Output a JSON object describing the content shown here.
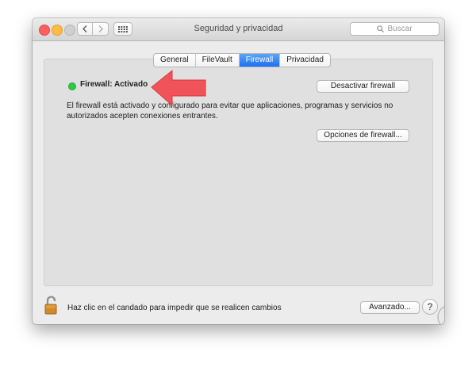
{
  "window": {
    "title": "Seguridad y privacidad",
    "search_placeholder": "Buscar"
  },
  "tabs": [
    {
      "label": "General",
      "active": false
    },
    {
      "label": "FileVault",
      "active": false
    },
    {
      "label": "Firewall",
      "active": true
    },
    {
      "label": "Privacidad",
      "active": false
    }
  ],
  "firewall": {
    "status_label": "Firewall: Activado",
    "status_color": "#2ecb40",
    "description": "El firewall está activado y configurado para evitar que aplicaciones, programas y servicios no autorizados acepten conexiones entrantes.",
    "deactivate_button": "Desactivar firewall",
    "options_button": "Opciones de firewall..."
  },
  "footer": {
    "lock_text": "Haz clic en el candado para impedir que se realicen cambios",
    "advanced_button": "Avanzado...",
    "help_label": "?"
  },
  "icons": {
    "lock": "unlocked-padlock-icon",
    "arrow": "red-annotation-arrow",
    "watermark": "solvetic-logo"
  },
  "accent": "#1e6ff0"
}
